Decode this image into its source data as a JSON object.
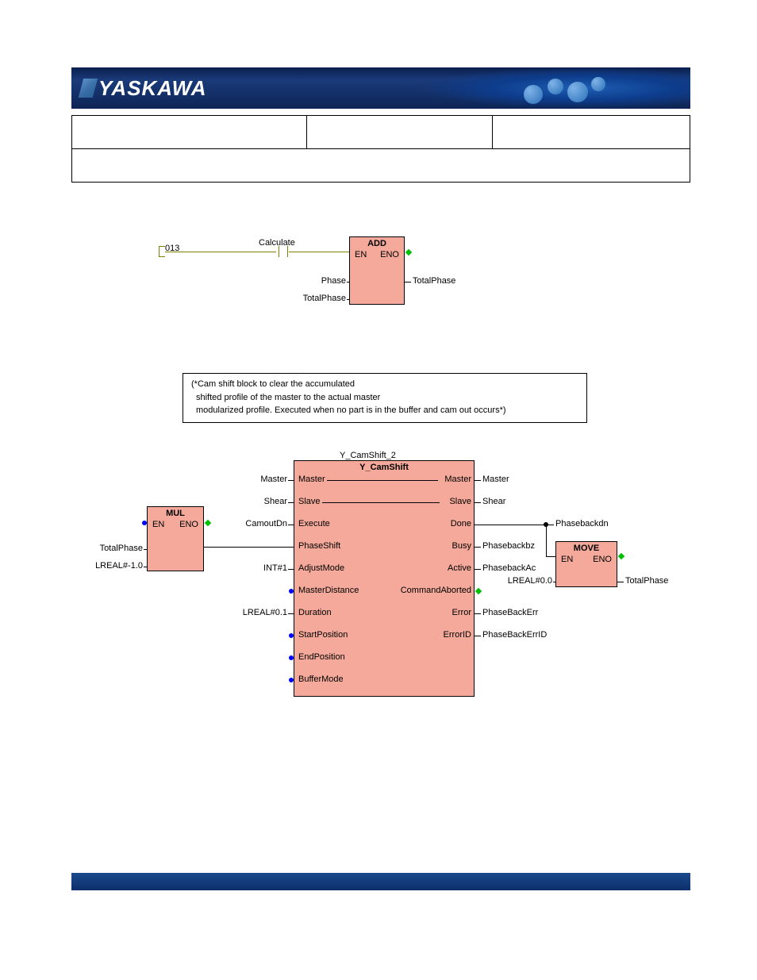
{
  "header": {
    "logo_text": "YASKAWA"
  },
  "rung013": {
    "number": "013",
    "contact_label": "Calculate",
    "block": {
      "title": "ADD",
      "en": "EN",
      "eno": "ENO",
      "in1": "Phase",
      "in2": "TotalPhase",
      "out": "TotalPhase"
    }
  },
  "comment": {
    "line1": "(*Cam shift block to clear the accumulated",
    "line2": "shifted profile of the master to the actual master",
    "line3": "modularized profile. Executed when no part is in the buffer and cam out occurs*)"
  },
  "mul_block": {
    "title": "MUL",
    "en": "EN",
    "eno": "ENO",
    "in1": "TotalPhase",
    "in2": "LREAL#-1.0"
  },
  "camshift": {
    "instance": "Y_CamShift_2",
    "type": "Y_CamShift",
    "inputs": {
      "master": "Master",
      "slave": "Slave",
      "execute": "Execute",
      "phaseshift": "PhaseShift",
      "adjustmode": "AdjustMode",
      "masterdistance": "MasterDistance",
      "duration": "Duration",
      "startposition": "StartPosition",
      "endposition": "EndPosition",
      "buffermode": "BufferMode"
    },
    "outputs": {
      "master": "Master",
      "slave": "Slave",
      "done": "Done",
      "busy": "Busy",
      "active": "Active",
      "commandaborted": "CommandAborted",
      "error": "Error",
      "errorid": "ErrorID"
    },
    "left_vars": {
      "master": "Master",
      "slave": "Shear",
      "execute": "CamoutDn",
      "adjustmode": "INT#1",
      "duration": "LREAL#0.1"
    },
    "right_vars": {
      "master": "Master",
      "slave": "Shear",
      "done": "Phasebackdn",
      "busy": "Phasebackbz",
      "active": "PhasebackAc",
      "error": "PhaseBackErr",
      "errorid": "PhaseBackErrID"
    }
  },
  "move_block": {
    "title": "MOVE",
    "en": "EN",
    "eno": "ENO",
    "in": "LREAL#0.0",
    "out": "TotalPhase"
  }
}
